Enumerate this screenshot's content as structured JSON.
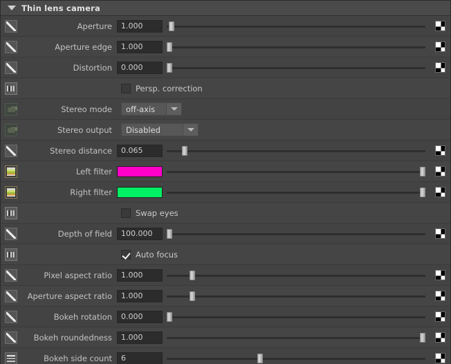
{
  "panel": {
    "title": "Thin lens camera",
    "collapse_icon": "triangle-down-icon",
    "expanded": true
  },
  "colors": {
    "panel_bg": "#434343",
    "header_bg": "#4a4a4a",
    "row_alt_bg": "#454545",
    "label_text": "#c3c3c3",
    "value_bg": "#2c2c2c",
    "left_filter": "#ff00c8",
    "right_filter": "#00f064",
    "slider_track": "#2e2e2e",
    "slider_handle": "#cccccc"
  },
  "rows": [
    {
      "id": "aperture",
      "icon": "curve-ramp-icon",
      "label": "Aperture",
      "type": "number-slider",
      "value": "1.000",
      "slider_pos_pct": 2,
      "end_icon": "checkerboard-icon"
    },
    {
      "id": "aperture-edge",
      "icon": "curve-ramp-icon",
      "label": "Aperture edge",
      "type": "number-slider",
      "value": "1.000",
      "slider_pos_pct": 1,
      "end_icon": "checkerboard-icon"
    },
    {
      "id": "distortion",
      "icon": "curve-ramp-icon",
      "label": "Distortion",
      "type": "number-slider",
      "value": "0.000",
      "slider_pos_pct": 1,
      "end_icon": "checkerboard-icon"
    },
    {
      "id": "persp-correction",
      "icon": "bool-toggle-icon",
      "label": "",
      "type": "checkbox",
      "checkbox_label": "Persp. correction",
      "checked": false,
      "end_icon": "none"
    },
    {
      "id": "stereo-mode",
      "icon": "node-plug-icon",
      "label": "Stereo mode",
      "type": "dropdown",
      "value": "off-axis",
      "dropdown_width": "narrow",
      "end_icon": "none"
    },
    {
      "id": "stereo-output",
      "icon": "node-plug-icon",
      "label": "Stereo output",
      "type": "dropdown",
      "value": "Disabled",
      "dropdown_width": "wide",
      "end_icon": "none"
    },
    {
      "id": "stereo-distance",
      "icon": "curve-ramp-icon",
      "label": "Stereo distance",
      "type": "number-slider",
      "value": "0.065",
      "slider_pos_pct": 7,
      "end_icon": "checkerboard-icon"
    },
    {
      "id": "left-filter",
      "icon": "gradient-image-icon",
      "label": "Left filter",
      "type": "color-slider",
      "value": "#ff00c8",
      "slider_pos_pct": 99,
      "end_icon": "checkerboard-icon"
    },
    {
      "id": "right-filter",
      "icon": "gradient-image-icon",
      "label": "Right filter",
      "type": "color-slider",
      "value": "#00f064",
      "slider_pos_pct": 99,
      "end_icon": "checkerboard-icon"
    },
    {
      "id": "swap-eyes",
      "icon": "bool-toggle-icon",
      "label": "",
      "type": "checkbox",
      "checkbox_label": "Swap eyes",
      "checked": false,
      "end_icon": "none"
    },
    {
      "id": "depth-of-field",
      "icon": "curve-ramp-icon",
      "label": "Depth of field",
      "type": "number-slider",
      "value": "100.000",
      "slider_pos_pct": 1,
      "end_icon": "checkerboard-icon"
    },
    {
      "id": "auto-focus",
      "icon": "bool-toggle-icon",
      "label": "",
      "type": "checkbox",
      "checkbox_label": "Auto focus",
      "checked": true,
      "end_icon": "none"
    },
    {
      "id": "pixel-aspect-ratio",
      "icon": "curve-ramp-icon",
      "label": "Pixel aspect ratio",
      "type": "number-slider",
      "value": "1.000",
      "slider_pos_pct": 10,
      "end_icon": "checkerboard-icon"
    },
    {
      "id": "aperture-aspect-ratio",
      "icon": "curve-ramp-icon",
      "label": "Aperture aspect ratio",
      "type": "number-slider",
      "value": "1.000",
      "slider_pos_pct": 10,
      "end_icon": "checkerboard-icon"
    },
    {
      "id": "bokeh-rotation",
      "icon": "curve-ramp-icon",
      "label": "Bokeh rotation",
      "type": "number-slider",
      "value": "0.000",
      "slider_pos_pct": 1,
      "end_icon": "checkerboard-icon"
    },
    {
      "id": "bokeh-roundedness",
      "icon": "curve-ramp-icon",
      "label": "Bokeh roundedness",
      "type": "number-slider",
      "value": "1.000",
      "slider_pos_pct": 99,
      "end_icon": "checkerboard-icon"
    },
    {
      "id": "bokeh-side-count",
      "icon": "int-slider-icon",
      "label": "Bokeh side count",
      "type": "number-slider",
      "value": "6",
      "slider_pos_pct": 36,
      "end_icon": "checkerboard-icon"
    }
  ]
}
